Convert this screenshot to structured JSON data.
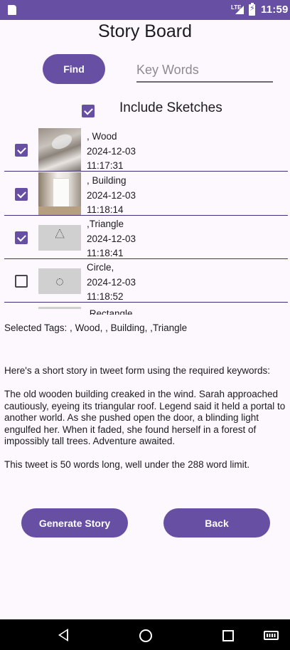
{
  "status_bar": {
    "network": "LTE",
    "time": "11:59"
  },
  "header": {
    "title": "Story Board"
  },
  "search": {
    "find_label": "Find",
    "placeholder": "Key Words",
    "value": ""
  },
  "include_sketches": {
    "label": "Include Sketches",
    "checked": true
  },
  "items": [
    {
      "tag": ", Wood",
      "date": "2024-12-03",
      "time": "11:17:31",
      "checked": true,
      "thumb": "photo-wood"
    },
    {
      "tag": ", Building",
      "date": "2024-12-03",
      "time": "11:18:14",
      "checked": true,
      "thumb": "photo-building"
    },
    {
      "tag": ",Triangle",
      "date": "2024-12-03",
      "time": "11:18:41",
      "checked": true,
      "thumb": "sketch-triangle"
    },
    {
      "tag": "Circle,",
      "date": "2024-12-03",
      "time": "11:18:52",
      "checked": false,
      "thumb": "sketch-circle"
    },
    {
      "tag": ",Rectangle",
      "date": "",
      "time": "",
      "checked": false,
      "thumb": "sketch-rectangle"
    }
  ],
  "selected_tags": "Selected Tags: , Wood, , Building, ,Triangle",
  "story": {
    "intro": "Here's a short story in tweet form using the required keywords:",
    "body": "The old wooden building creaked in the wind. Sarah approached cautiously, eyeing its triangular roof. Legend said it held a portal to another world. As she pushed open the door, a blinding light engulfed her. When it faded, she found herself in a forest of impossibly tall trees. Adventure awaited.",
    "footer": "This tweet is 50 words long, well under the 288 word limit."
  },
  "buttons": {
    "generate": "Generate Story",
    "back": "Back"
  },
  "colors": {
    "primary": "#6750a4",
    "background": "#fdf7fe",
    "divider": "#3f2f7a"
  }
}
